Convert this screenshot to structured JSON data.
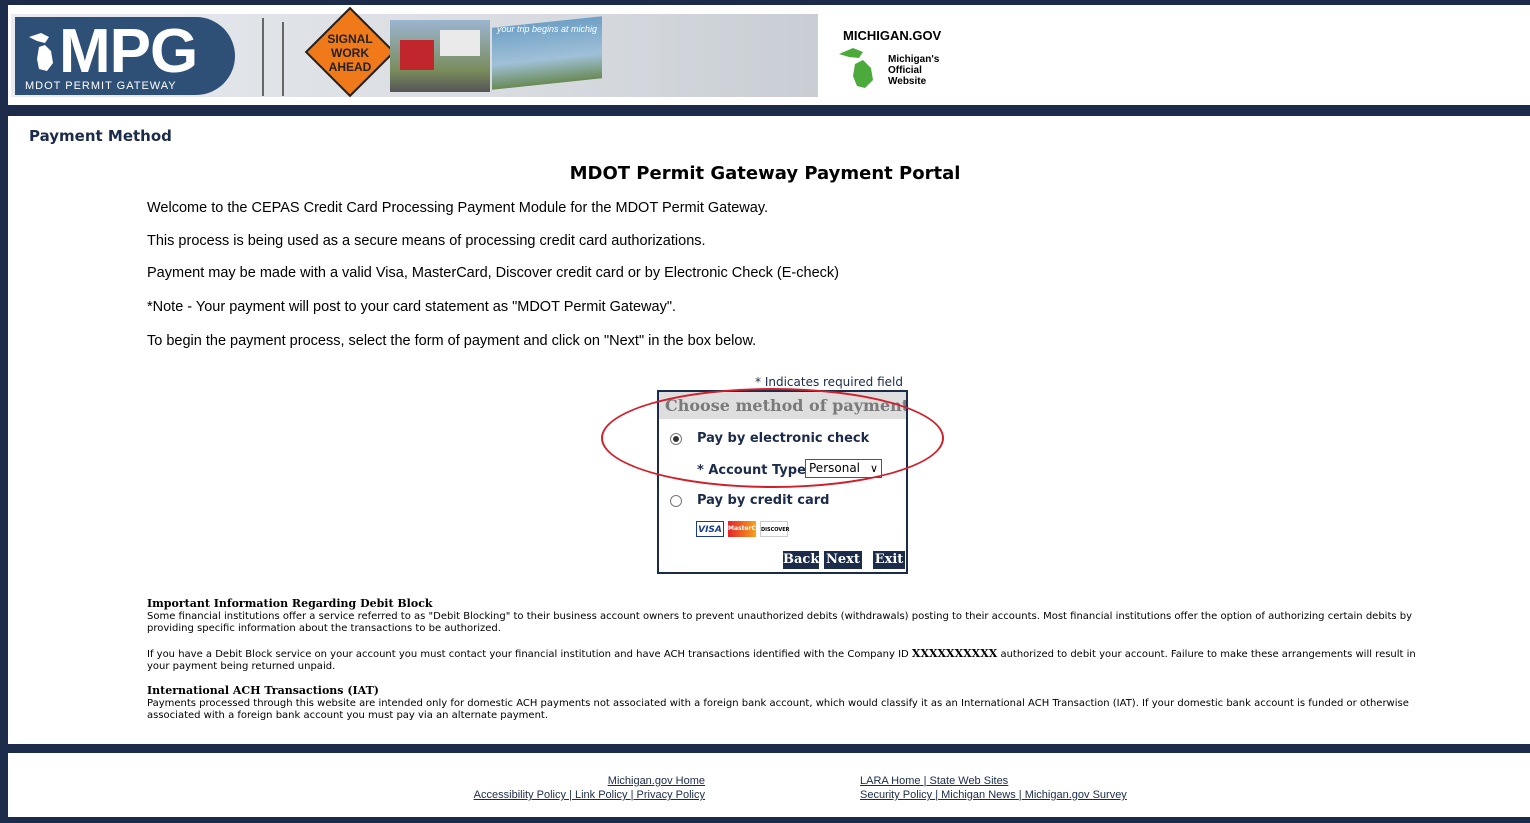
{
  "header": {
    "logo_text": "MPG",
    "logo_sub": "MDOT PERMIT GATEWAY",
    "sign_text": [
      "SIGNAL",
      "WORK",
      "AHEAD"
    ],
    "billboard_text": "your trip begins at michig",
    "michigan_gov": "MICHIGAN.GOV",
    "michigan_tag": [
      "Michigan's",
      "Official",
      "Website"
    ]
  },
  "page": {
    "section_title": "Payment Method",
    "portal_title": "MDOT Permit Gateway Payment Portal",
    "intro": [
      "Welcome to the CEPAS Credit Card Processing Payment Module for the MDOT Permit Gateway.",
      "This process is being used as a secure means of processing credit card authorizations.",
      "Payment may be made with a valid Visa, MasterCard, Discover credit card or by Electronic Check (E-check)",
      "*Note - Your payment will post to your card statement as \"MDOT Permit Gateway\".",
      "To begin the payment process, select the form of payment and click on \"Next\" in the box below."
    ]
  },
  "payment_box": {
    "required_note": "* Indicates required field",
    "heading": "Choose method of payment",
    "option_echeck": "Pay by electronic check",
    "account_type_label": "* Account Type:",
    "account_type_value": "Personal",
    "option_credit": "Pay by credit card",
    "cards": [
      "VISA",
      "MasterCard",
      "DISCOVER"
    ],
    "buttons": {
      "back": "Back",
      "next": "Next",
      "exit": "Exit"
    },
    "selected": "electronic check"
  },
  "info": {
    "debit_title": "Important Information Regarding Debit Block",
    "debit_text": "Some financial institutions offer a service referred to as \"Debit Blocking\" to their business account owners to prevent unauthorized debits (withdrawals) posting to their accounts.  Most financial institutions offer the option of authorizing certain debits by providing specific information about the transactions to be authorized.",
    "debit_text2_a": "If you have a Debit Block service on your account you must contact your financial institution and have ACH transactions identified with the Company ID ",
    "company_id": "XXXXXXXXXX",
    "debit_text2_b": " authorized to debit your account.  Failure to make these arrangements will result in your payment being returned unpaid.",
    "iat_title": "International ACH Transactions (IAT)",
    "iat_text": "Payments processed through this website are intended only for domestic ACH payments not associated with a foreign bank account, which would classify it as an International ACH Transaction (IAT). If your domestic bank account is funded or otherwise associated with a foreign bank account you must pay via an alternate payment."
  },
  "footer": {
    "home": "Michigan.gov Home",
    "accessibility": "Accessibility Policy",
    "link_policy": "Link Policy",
    "privacy": "Privacy Policy",
    "lara": "LARA Home",
    "state_sites": "State Web Sites",
    "security": "Security Policy",
    "news": "Michigan News",
    "survey": "Michigan.gov Survey",
    "separator": "|"
  },
  "colors": {
    "navy": "#1c2b4a",
    "highlight": "#d11f2b"
  }
}
